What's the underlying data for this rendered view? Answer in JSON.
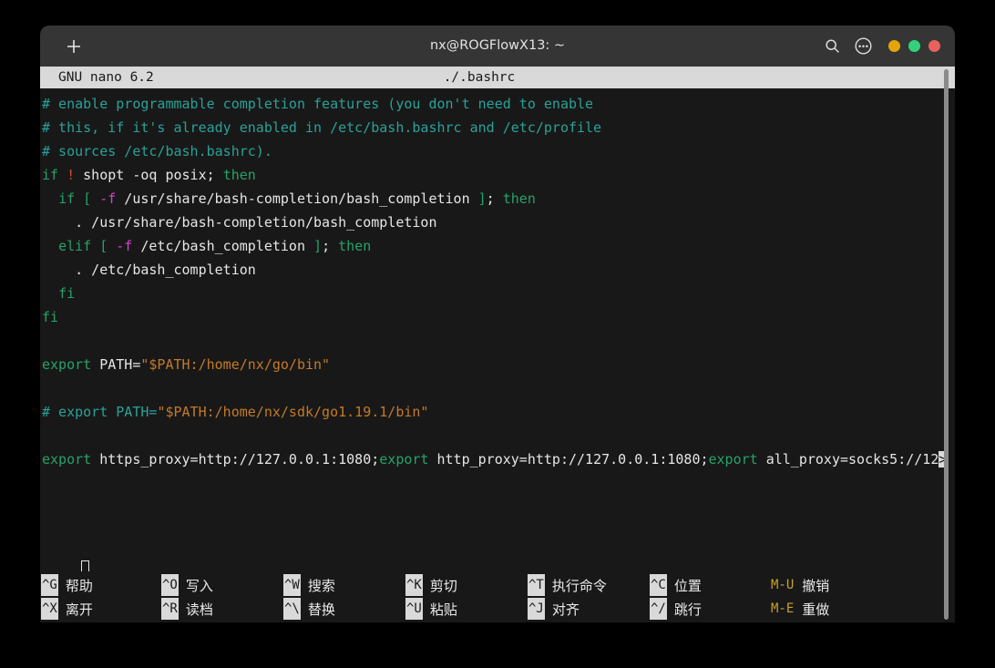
{
  "window": {
    "title": "nx@ROGFlowX13: ~",
    "new_tab_label": "+",
    "icons": {
      "search": "search-icon",
      "menu": "ellipsis-menu-icon"
    },
    "buttons": {
      "minimize_color": "#e5a50a",
      "maximize_color": "#33d17a",
      "close_color": "#e8615c"
    }
  },
  "nano": {
    "version": "GNU nano 6.2",
    "filename": "./.bashrc",
    "lines": [
      [
        {
          "t": "# enable programmable completion features (you don't need to enable",
          "c": "comment"
        }
      ],
      [
        {
          "t": "# this, if it's already enabled in /etc/bash.bashrc and /etc/profile",
          "c": "comment"
        }
      ],
      [
        {
          "t": "# sources /etc/bash.bashrc).",
          "c": "comment"
        }
      ],
      [
        {
          "t": "if",
          "c": "keyword"
        },
        {
          "t": " ",
          "c": "plain"
        },
        {
          "t": "!",
          "c": "bang"
        },
        {
          "t": " shopt -oq posix; ",
          "c": "plain"
        },
        {
          "t": "then",
          "c": "keyword"
        }
      ],
      [
        {
          "t": "  ",
          "c": "plain"
        },
        {
          "t": "if",
          "c": "keyword"
        },
        {
          "t": " ",
          "c": "plain"
        },
        {
          "t": "[",
          "c": "punct"
        },
        {
          "t": " ",
          "c": "plain"
        },
        {
          "t": "-f",
          "c": "flag"
        },
        {
          "t": " /usr/share/bash-completion/bash_completion ",
          "c": "plain"
        },
        {
          "t": "]",
          "c": "punct"
        },
        {
          "t": "; ",
          "c": "plain"
        },
        {
          "t": "then",
          "c": "keyword"
        }
      ],
      [
        {
          "t": "    . /usr/share/bash-completion/bash_completion",
          "c": "plain"
        }
      ],
      [
        {
          "t": "  ",
          "c": "plain"
        },
        {
          "t": "elif",
          "c": "keyword"
        },
        {
          "t": " ",
          "c": "plain"
        },
        {
          "t": "[",
          "c": "punct"
        },
        {
          "t": " ",
          "c": "plain"
        },
        {
          "t": "-f",
          "c": "flag"
        },
        {
          "t": " /etc/bash_completion ",
          "c": "plain"
        },
        {
          "t": "]",
          "c": "punct"
        },
        {
          "t": "; ",
          "c": "plain"
        },
        {
          "t": "then",
          "c": "keyword"
        }
      ],
      [
        {
          "t": "    . /etc/bash_completion",
          "c": "plain"
        }
      ],
      [
        {
          "t": "  ",
          "c": "plain"
        },
        {
          "t": "fi",
          "c": "keyword"
        }
      ],
      [
        {
          "t": "fi",
          "c": "keyword"
        }
      ],
      [
        {
          "t": "",
          "c": "plain"
        }
      ],
      [
        {
          "t": "export",
          "c": "keyword"
        },
        {
          "t": " PATH=",
          "c": "plain"
        },
        {
          "t": "\"$PATH:/home/nx/go/bin\"",
          "c": "string"
        }
      ],
      [
        {
          "t": "",
          "c": "plain"
        }
      ],
      [
        {
          "t": "# export PATH=",
          "c": "comment"
        },
        {
          "t": "\"$PATH:/home/nx/sdk/go1.19.1/bin\"",
          "c": "string"
        }
      ],
      [
        {
          "t": "",
          "c": "plain"
        }
      ],
      [
        {
          "t": "export",
          "c": "keyword"
        },
        {
          "t": " https_proxy=http://127.0.0.1:1080;",
          "c": "plain"
        },
        {
          "t": "export",
          "c": "keyword"
        },
        {
          "t": " http_proxy=http://127.0.0.1:1080;",
          "c": "plain"
        },
        {
          "t": "export",
          "c": "keyword"
        },
        {
          "t": " all_proxy=socks5://12",
          "c": "plain"
        },
        {
          "t": ">",
          "c": "more"
        }
      ]
    ]
  },
  "shortcuts": [
    [
      {
        "key": "^G",
        "label": "帮助",
        "inverted": true
      },
      {
        "key": "^X",
        "label": "离开",
        "inverted": true
      }
    ],
    [
      {
        "key": "^O",
        "label": "写入",
        "inverted": true
      },
      {
        "key": "^R",
        "label": "读档",
        "inverted": true
      }
    ],
    [
      {
        "key": "^W",
        "label": "搜索",
        "inverted": true
      },
      {
        "key": "^\\",
        "label": "替换",
        "inverted": true
      }
    ],
    [
      {
        "key": "^K",
        "label": "剪切",
        "inverted": true
      },
      {
        "key": "^U",
        "label": "粘贴",
        "inverted": true
      }
    ],
    [
      {
        "key": "^T",
        "label": "执行命令",
        "inverted": true
      },
      {
        "key": "^J",
        "label": "对齐",
        "inverted": true
      }
    ],
    [
      {
        "key": "^C",
        "label": "位置",
        "inverted": true
      },
      {
        "key": "^/",
        "label": "跳行",
        "inverted": true
      }
    ],
    [
      {
        "key": "M-U",
        "label": "撤销",
        "inverted": false
      },
      {
        "key": "M-E",
        "label": "重做",
        "inverted": false
      }
    ]
  ]
}
